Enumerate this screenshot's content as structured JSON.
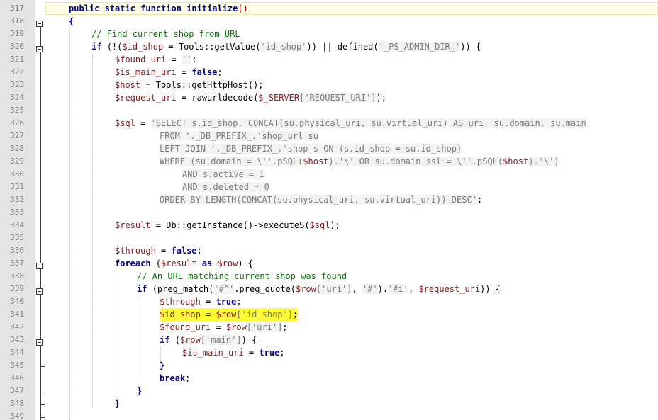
{
  "editor": {
    "line_numbers": [
      "317",
      "318",
      "319",
      "320",
      "321",
      "322",
      "323",
      "324",
      "325",
      "326",
      "327",
      "328",
      "329",
      "330",
      "331",
      "332",
      "333",
      "334",
      "335",
      "336",
      "337",
      "338",
      "339",
      "340",
      "341",
      "342",
      "343",
      "344",
      "345",
      "346",
      "347",
      "348",
      "349"
    ]
  },
  "code": {
    "l317": {
      "kw1": "public static function ",
      "fn": "initialize",
      "paren": "()"
    },
    "l318": {
      "t": "{"
    },
    "l319": {
      "t": "// Find current shop from URL"
    },
    "l320": {
      "kw": "if ",
      "a": "(!(",
      "v1": "$id_shop",
      "b": " = Tools::getValue(",
      "s1": "'id_shop'",
      "c": ")) || defined(",
      "s2": "'_PS_ADMIN_DIR_'",
      "d": ")) {"
    },
    "l321": {
      "v": "$found_uri",
      "a": " = ",
      "s": "''",
      "b": ";"
    },
    "l322": {
      "v": "$is_main_uri",
      "a": " = ",
      "k": "false",
      "b": ";"
    },
    "l323": {
      "v": "$host",
      "a": " = Tools::getHttpHost();"
    },
    "l324": {
      "v": "$request_uri",
      "a": " = rawurldecode(",
      "v2": "$_SERVER",
      "s": "['REQUEST_URI']",
      "b": ");"
    },
    "l326": {
      "v": "$sql",
      "a": " = ",
      "s": "'SELECT s.id_shop, CONCAT(su.physical_uri, su.virtual_uri) AS uri, su.domain, su.main"
    },
    "l327": {
      "s": "FROM '._DB_PREFIX_.'shop_url su"
    },
    "l328": {
      "s": "LEFT JOIN '._DB_PREFIX_.'shop s ON (s.id_shop = su.id_shop)"
    },
    "l329": {
      "s1": "WHERE (su.domain = \\''.pSQL(",
      "v1": "$host",
      "s2": ").'\\' OR su.domain_ssl = \\''.pSQL(",
      "v2": "$host",
      "s3": ").'\\')"
    },
    "l330": {
      "s": "AND s.active = 1"
    },
    "l331": {
      "s": "AND s.deleted = 0"
    },
    "l332": {
      "s": "ORDER BY LENGTH(CONCAT(su.physical_uri, su.virtual_uri)) DESC'",
      "b": ";"
    },
    "l334": {
      "v": "$result",
      "a": " = Db::getInstance()->executeS(",
      "v2": "$sql",
      "b": ");"
    },
    "l336": {
      "v": "$through",
      "a": " = ",
      "k": "false",
      "b": ";"
    },
    "l337": {
      "kw": "foreach ",
      "a": "(",
      "v1": "$result",
      "k": " as ",
      "v2": "$row",
      "b": ") {"
    },
    "l338": {
      "t": "// An URL matching current shop was found"
    },
    "l339": {
      "kw": "if ",
      "a": "(preg_match(",
      "s1": "'#^'",
      "b": ".preg_quote(",
      "v1": "$row",
      "s2": "['uri']",
      "c": ", ",
      "s3": "'#'",
      "d": ").",
      "s4": "'#i'",
      "e": ", ",
      "v2": "$request_uri",
      "f": ")) {"
    },
    "l340": {
      "v": "$through",
      "a": " = ",
      "k": "true",
      "b": ";"
    },
    "l341": {
      "v1": "$id_shop",
      "a": " = ",
      "v2": "$row",
      "s": "['id_shop']",
      "b": ";"
    },
    "l342": {
      "v1": "$found_uri",
      "a": " = ",
      "v2": "$row",
      "s": "['uri']",
      "b": ";"
    },
    "l343": {
      "kw": "if ",
      "a": "(",
      "v": "$row",
      "s": "['main']",
      "b": ") {"
    },
    "l344": {
      "v": "$is_main_uri",
      "a": " = ",
      "k": "true",
      "b": ";"
    },
    "l345": {
      "t": "}"
    },
    "l346": {
      "kw": "break",
      "b": ";"
    },
    "l347": {
      "t": "}"
    },
    "l348": {
      "t": "}"
    }
  },
  "colors": {
    "keyword": "#00008b",
    "variable": "#8b1a1a",
    "string": "#7a7a7a",
    "comment": "#007f00",
    "fold_marker": "#cc0000",
    "highlight": "#ffff33",
    "gutter": "#e4e4e4"
  }
}
